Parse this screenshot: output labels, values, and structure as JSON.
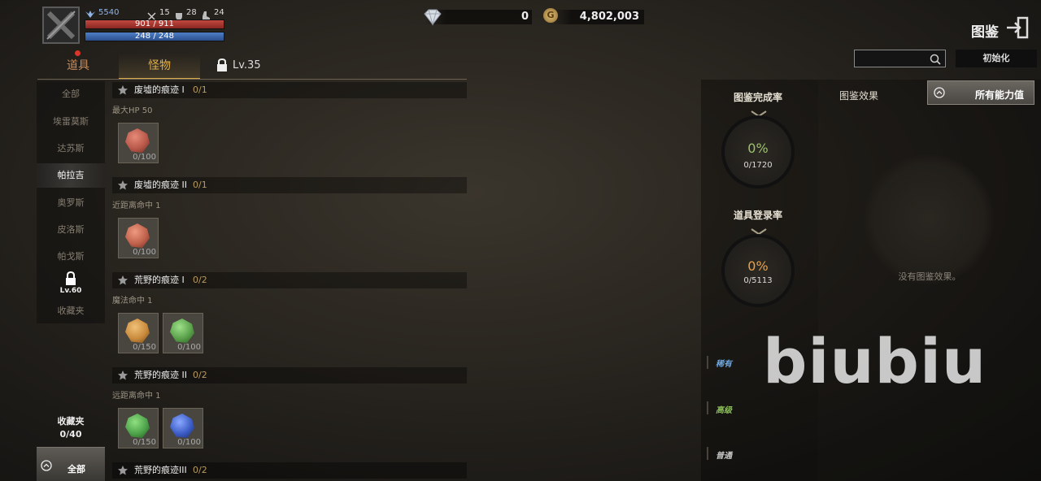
{
  "player": {
    "power_icon": "winged-emblem-icon",
    "power": "5540",
    "stats": [
      {
        "icon": "crossed-swords-icon",
        "value": "15"
      },
      {
        "icon": "shield-icon",
        "value": "28"
      },
      {
        "icon": "boot-icon",
        "value": "24"
      }
    ],
    "hp": "901 / 911",
    "hp_fraction": 0.989,
    "mp": "248 / 248",
    "mp_fraction": 1.0
  },
  "currency": {
    "diamonds": "0",
    "gold_symbol": "G",
    "gold": "4,802,003"
  },
  "header": {
    "title": "图鉴",
    "exit_icon": "exit-icon"
  },
  "tabs": [
    {
      "label": "道具",
      "has_badge": true
    },
    {
      "label": "怪物",
      "active": true
    },
    {
      "label": "Lv.35",
      "locked": true
    }
  ],
  "search": {
    "placeholder": "",
    "reset_label": "初始化"
  },
  "categories": [
    "全部",
    "埃雷莫斯",
    "达苏斯",
    "帕拉吉",
    "奥罗斯",
    "皮洛斯",
    "帕戈斯"
  ],
  "active_category": "帕拉吉",
  "locked_category": {
    "level": "Lv.60",
    "label": "收藏夹"
  },
  "favorites": {
    "label": "收藏夹",
    "count": "0/40"
  },
  "bottom_button": {
    "label": "全部"
  },
  "entries": [
    {
      "title": "废墟的痕迹 I",
      "progress": "0/1",
      "bonus": "最大HP 50",
      "items": [
        {
          "color": "#b8584a",
          "count": "0/100"
        }
      ]
    },
    {
      "title": "废墟的痕迹 II",
      "progress": "0/1",
      "bonus": "近距离命中 1",
      "items": [
        {
          "color": "#c0614c",
          "count": "0/100"
        }
      ]
    },
    {
      "title": "荒野的痕迹 I",
      "progress": "0/2",
      "bonus": "魔法命中 1",
      "items": [
        {
          "color": "#c98a3c",
          "count": "0/150"
        },
        {
          "color": "#5aa04a",
          "count": "0/100"
        }
      ]
    },
    {
      "title": "荒野的痕迹 II",
      "progress": "0/2",
      "bonus": "远距离命中 1",
      "items": [
        {
          "color": "#4da24a",
          "count": "0/150"
        },
        {
          "color": "#3b5cc4",
          "count": "0/100"
        }
      ]
    },
    {
      "title": "荒野的痕迹III",
      "progress": "0/2",
      "bonus": "",
      "items": []
    }
  ],
  "completion": {
    "label": "图鉴完成率",
    "percent": "0%",
    "count": "0/1720",
    "percent_color": "#9ac26a"
  },
  "registration": {
    "label": "道具登录率",
    "percent": "0%",
    "count": "0/5113",
    "percent_color": "#e8a04a"
  },
  "rarity": [
    {
      "label": "稀有",
      "color": "#6fa8e0"
    },
    {
      "label": "高级",
      "color": "#8cc05a"
    },
    {
      "label": "普通",
      "color": "#c8c8c8"
    }
  ],
  "effects": {
    "title": "图鉴效果",
    "all_stats_label": "所有能力值",
    "empty_text": "没有图鉴效果。"
  },
  "watermark": "biubiu"
}
